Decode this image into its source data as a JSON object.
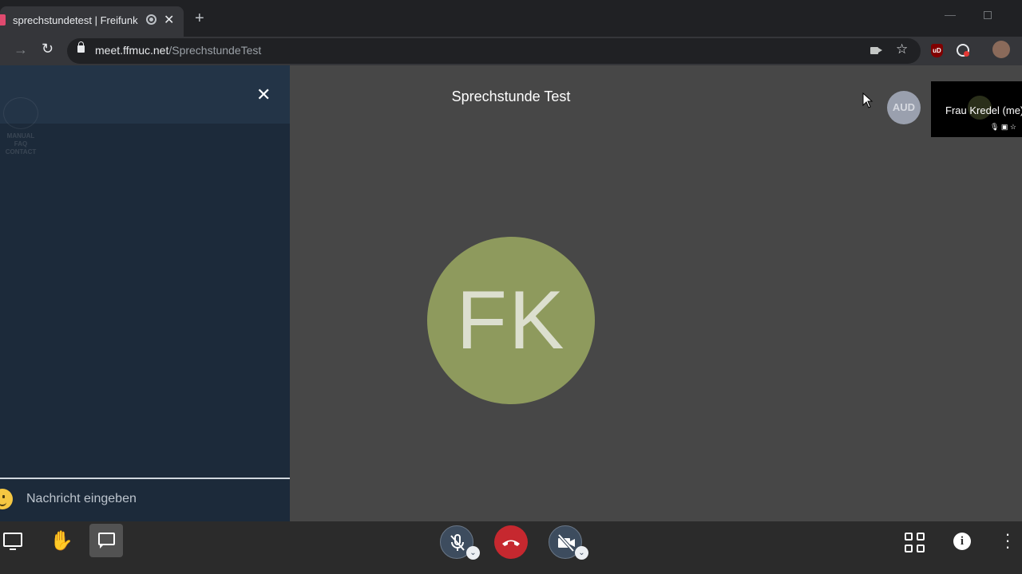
{
  "browser": {
    "tab_title": "sprechstundetest | Freifunk M",
    "tab_close": "✕",
    "new_tab": "+",
    "url_host": "meet.ffmuc.net",
    "url_path": "/SprechstundeTest",
    "minimize": "—"
  },
  "chat": {
    "close": "✕",
    "input_placeholder": "Nachricht eingeben",
    "ghost_links": [
      "MANUAL",
      "FAQ",
      "CONTACT"
    ]
  },
  "meeting": {
    "title": "Sprechstunde Test",
    "main_avatar_initials": "FK",
    "aud_badge": "AUD",
    "self_name": "Frau Kredel (me)"
  },
  "colors": {
    "stage_bg": "#474747",
    "chat_bg": "#1c2a3a",
    "avatar_bg": "#8e9a5d",
    "hangup_red": "#c6282f"
  },
  "icons": {
    "share": "desktop-icon",
    "hand": "raise-hand-icon",
    "chat": "chat-icon",
    "mic": "mic-off-icon",
    "hangup": "hangup-icon",
    "video": "video-off-icon",
    "tile": "tile-view-icon",
    "info": "info-icon",
    "more": "more-icon"
  }
}
